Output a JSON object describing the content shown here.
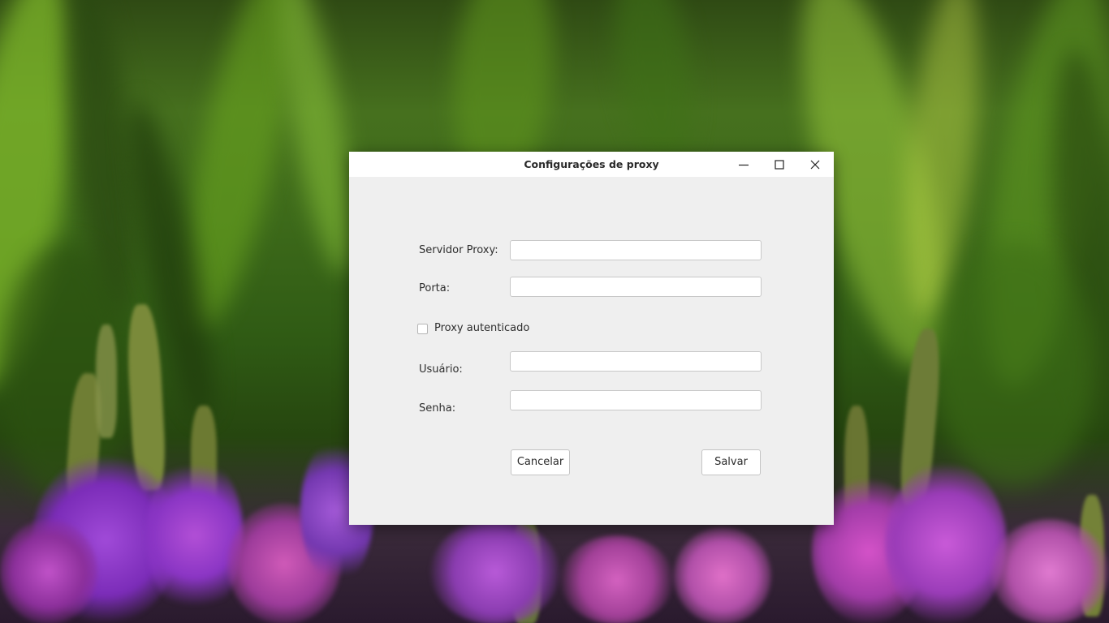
{
  "window": {
    "title": "Configurações de proxy"
  },
  "window_controls": {
    "minimize_icon": "minimize-icon",
    "maximize_icon": "maximize-icon",
    "close_icon": "close-icon"
  },
  "form": {
    "proxy_server_label": "Servidor Proxy:",
    "proxy_server_value": "",
    "port_label": "Porta:",
    "port_value": "",
    "authenticated_label": "Proxy autenticado",
    "authenticated_checked": false,
    "user_label": "Usuário:",
    "user_value": "",
    "password_label": "Senha:",
    "password_value": ""
  },
  "buttons": {
    "cancel_label": "Cancelar",
    "save_label": "Salvar"
  },
  "colors": {
    "dialog_background": "#efefef",
    "titlebar_background": "#ffffff",
    "text": "#2e2e2e"
  }
}
